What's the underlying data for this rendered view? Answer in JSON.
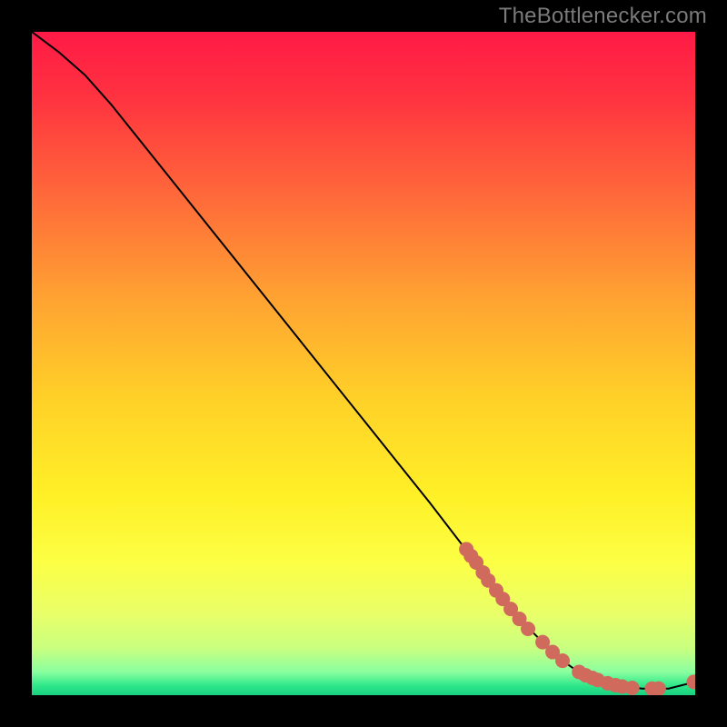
{
  "watermark": "TheBottlenecker.com",
  "chart_data": {
    "type": "line",
    "title": "",
    "xlabel": "",
    "ylabel": "",
    "xlim": [
      0,
      100
    ],
    "ylim": [
      0,
      100
    ],
    "grid": false,
    "series": [
      {
        "name": "curve",
        "x": [
          0,
          4,
          8,
          12,
          20,
          30,
          40,
          50,
          60,
          65,
          70,
          73,
          76,
          78,
          80,
          82,
          85,
          88,
          92,
          96,
          100
        ],
        "y": [
          100,
          97,
          93.5,
          89,
          79,
          66.5,
          54,
          41.5,
          29,
          22.5,
          16,
          12,
          9,
          7,
          5.2,
          3.8,
          2.5,
          1.5,
          1.0,
          1.0,
          2.0
        ],
        "stroke": "#000000"
      }
    ],
    "points": {
      "name": "markers",
      "color": "#cf6a5d",
      "radius": 8,
      "coords": [
        [
          65.5,
          22.0
        ],
        [
          66.2,
          21.0
        ],
        [
          67.0,
          20.0
        ],
        [
          68.0,
          18.5
        ],
        [
          68.8,
          17.3
        ],
        [
          70.0,
          15.8
        ],
        [
          71.0,
          14.5
        ],
        [
          72.2,
          13.0
        ],
        [
          73.5,
          11.5
        ],
        [
          74.8,
          10.0
        ],
        [
          77.0,
          8.0
        ],
        [
          78.5,
          6.5
        ],
        [
          80.0,
          5.2
        ],
        [
          82.5,
          3.5
        ],
        [
          83.5,
          3.0
        ],
        [
          84.5,
          2.6
        ],
        [
          85.3,
          2.3
        ],
        [
          86.8,
          1.8
        ],
        [
          88.0,
          1.5
        ],
        [
          89.0,
          1.3
        ],
        [
          90.5,
          1.1
        ],
        [
          93.5,
          1.0
        ],
        [
          94.5,
          1.0
        ],
        [
          99.8,
          2.0
        ]
      ]
    },
    "background_gradient": {
      "stops": [
        {
          "offset": 0.0,
          "color": "#ff1a46"
        },
        {
          "offset": 0.1,
          "color": "#ff3340"
        },
        {
          "offset": 0.25,
          "color": "#ff6a3a"
        },
        {
          "offset": 0.4,
          "color": "#ffa232"
        },
        {
          "offset": 0.55,
          "color": "#ffd028"
        },
        {
          "offset": 0.7,
          "color": "#fff027"
        },
        {
          "offset": 0.8,
          "color": "#fcff45"
        },
        {
          "offset": 0.88,
          "color": "#e8ff6a"
        },
        {
          "offset": 0.93,
          "color": "#c8ff80"
        },
        {
          "offset": 0.965,
          "color": "#8affa0"
        },
        {
          "offset": 0.985,
          "color": "#30e88a"
        },
        {
          "offset": 1.0,
          "color": "#18cf80"
        }
      ]
    }
  }
}
